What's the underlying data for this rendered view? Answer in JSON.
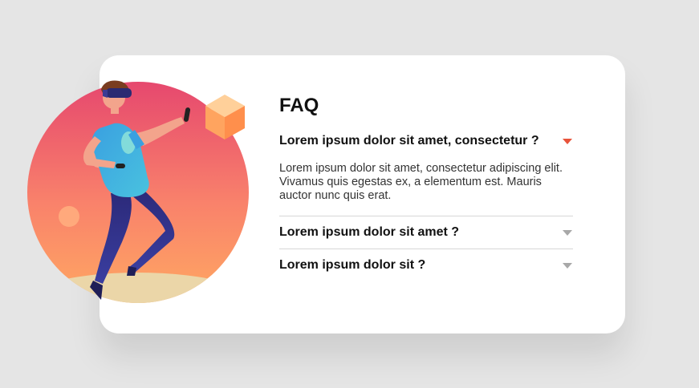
{
  "faq": {
    "title": "FAQ",
    "items": [
      {
        "question": "Lorem ipsum dolor sit amet, consectetur ?",
        "answer": "Lorem ipsum dolor sit amet, consectetur adipiscing elit. Vivamus quis egestas ex, a elementum est. Mauris auctor nunc quis erat.",
        "expanded": true
      },
      {
        "question": "Lorem ipsum dolor sit amet ?",
        "expanded": false
      },
      {
        "question": "Lorem ipsum dolor sit ?",
        "expanded": false
      }
    ]
  },
  "colors": {
    "background": "#e5e5e5",
    "card": "#ffffff",
    "accent": "#e8533a",
    "chevron_inactive": "#a8a8a8",
    "divider": "#d7d7d7"
  },
  "icons": {
    "expanded": "chevron-down-icon-active",
    "collapsed": "chevron-down-icon"
  }
}
